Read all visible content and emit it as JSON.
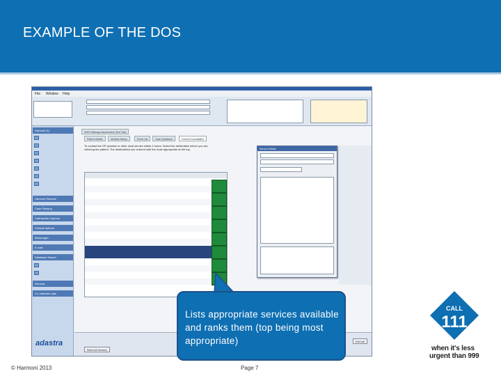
{
  "slide": {
    "title": "EXAMPLE OF THE DOS",
    "callout_text": "Lists appropriate services available and ranks them (top being most appropriate)",
    "badge_call": "CALL",
    "badge_number": "111",
    "badge_line1": "when it's less",
    "badge_line2": "urgent than 999",
    "footer_left": "© Harmoni 2013",
    "footer_page": "Page 7"
  },
  "app": {
    "menu": [
      "File",
      "Window",
      "Help"
    ],
    "sidebar_heads": [
      "Harmoni (1)",
      "Harmoni Referral",
      "Case Passing",
      "CallHandler Options",
      "Clinical Options",
      "Messenger",
      "E-mail",
      "Database Search",
      "General",
      "Co-ordinator opts"
    ],
    "logo": "adastra",
    "tabs": [
      "NHS Pathways Assessment (Test Test)",
      "Patient Details",
      "Medical History",
      "Event List",
      "Case Questions",
      "Current Consultation"
    ],
    "instructions": "To contact the GP practice or other local service within 2 hours. Select the destination where you are referring the patient. The destinations are ordered with the most appropriate at the top.",
    "popup_title": "Service Details",
    "bottom_buttons": [
      "Select All Services",
      "Cancel",
      "Exit Call"
    ]
  },
  "colors": {
    "header_blue": "#0e6fb3",
    "service_green": "#1f8a3b",
    "selected_row": "#28457d"
  }
}
